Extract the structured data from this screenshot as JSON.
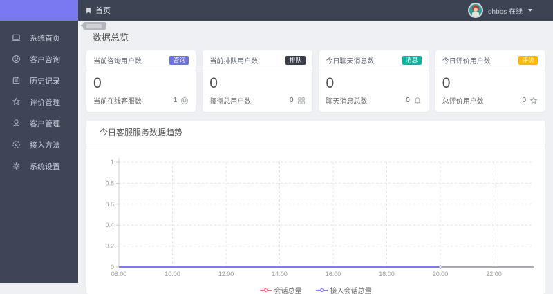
{
  "topbar": {
    "breadcrumb": "首页",
    "user_name": "ohbbs",
    "user_status": "在线"
  },
  "sidebar": {
    "items": [
      {
        "label": "系统首页",
        "icon": "window-icon"
      },
      {
        "label": "客户咨询",
        "icon": "smiley-icon"
      },
      {
        "label": "历史记录",
        "icon": "history-icon"
      },
      {
        "label": "评价管理",
        "icon": "star-icon"
      },
      {
        "label": "客户管理",
        "icon": "user-icon"
      },
      {
        "label": "接入方法",
        "icon": "dashed-gear-icon"
      },
      {
        "label": "系统设置",
        "icon": "gear-icon"
      }
    ]
  },
  "overview": {
    "title": "数据总览",
    "cards": [
      {
        "title": "当前咨询用户数",
        "badge": "咨询",
        "badge_color": "#6e73e1",
        "value": "0",
        "footer_label": "当前在线客服数",
        "footer_value": "1",
        "icon": "smiley-icon"
      },
      {
        "title": "当前排队用户数",
        "badge": "排队",
        "badge_color": "#393d49",
        "value": "0",
        "footer_label": "接待总用户数",
        "footer_value": "0",
        "icon": "users-icon"
      },
      {
        "title": "今日聊天消息数",
        "badge": "消息",
        "badge_color": "#12b2a0",
        "value": "0",
        "footer_label": "聊天消息总数",
        "footer_value": "0",
        "icon": "bell-icon"
      },
      {
        "title": "今日评价用户数",
        "badge": "评价",
        "badge_color": "#ffb800",
        "value": "0",
        "footer_label": "总评价用户数",
        "footer_value": "0",
        "icon": "star-icon"
      }
    ]
  },
  "trend": {
    "title": "今日客服服务数据趋势"
  },
  "chart_data": {
    "type": "line",
    "title": "今日客服服务数据趋势",
    "x_labels": [
      "08:00",
      "10:00",
      "12:00",
      "14:00",
      "16:00",
      "18:00",
      "20:00",
      "22:00"
    ],
    "ylim": [
      0,
      1
    ],
    "y_ticks": [
      0,
      0.2,
      0.4,
      0.6,
      0.8,
      1
    ],
    "grid": true,
    "legend_position": "bottom",
    "series": [
      {
        "name": "会话总量",
        "color": "#f56c6c",
        "x": [
          "08:00",
          "09:00",
          "10:00",
          "11:00",
          "12:00",
          "13:00",
          "14:00",
          "15:00",
          "16:00",
          "17:00",
          "18:00",
          "19:00",
          "20:00"
        ],
        "values": [
          0,
          0,
          0,
          0,
          0,
          0,
          0,
          0,
          0,
          0,
          0,
          0,
          0
        ]
      },
      {
        "name": "接入会话总量",
        "color": "#7b7af2",
        "x": [
          "08:00",
          "09:00",
          "10:00",
          "11:00",
          "12:00",
          "13:00",
          "14:00",
          "15:00",
          "16:00",
          "17:00",
          "18:00",
          "19:00",
          "20:00"
        ],
        "values": [
          0,
          0,
          0,
          0,
          0,
          0,
          0,
          0,
          0,
          0,
          0,
          0,
          0
        ]
      }
    ],
    "colors": {
      "axis_bottom": "#a8abb3",
      "axis_left": "#cccccc",
      "grid_line": "#e2e4e9",
      "tick_label": "#999999"
    }
  }
}
